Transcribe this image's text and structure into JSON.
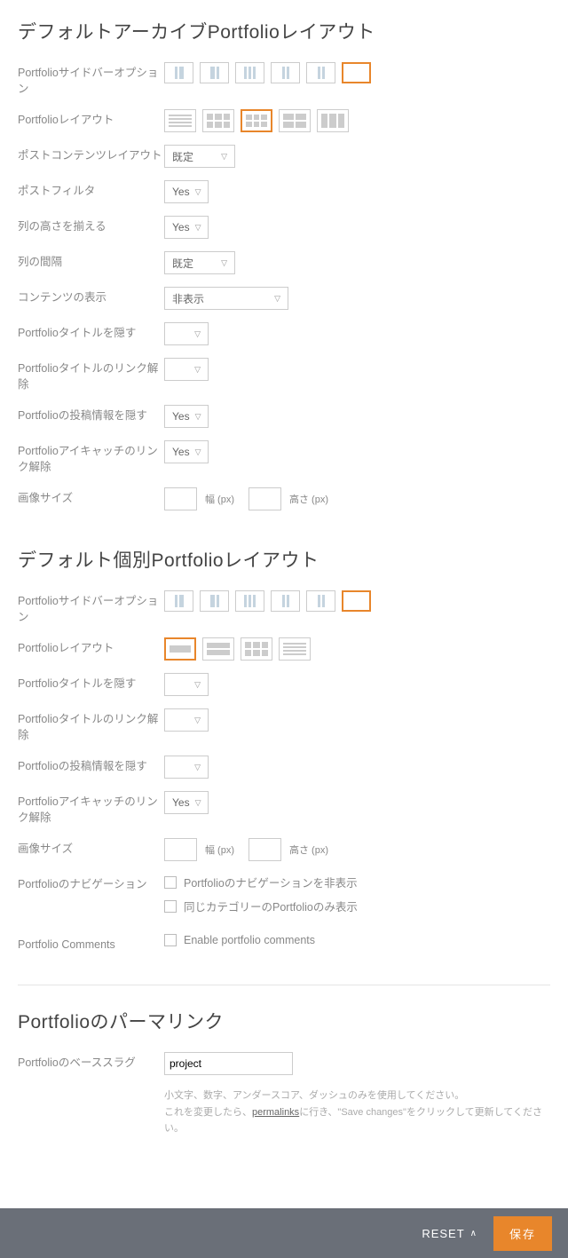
{
  "section1": {
    "title": "デフォルトアーカイブPortfolioレイアウト",
    "sidebar_opt_label": "Portfolioサイドバーオプション",
    "layout_label": "Portfolioレイアウト",
    "post_content_layout_label": "ポストコンテンツレイアウト",
    "post_content_layout_value": "既定",
    "post_filter_label": "ポストフィルタ",
    "post_filter_value": "Yes",
    "equalize_height_label": "列の高さを揃える",
    "equalize_height_value": "Yes",
    "column_gap_label": "列の間隔",
    "column_gap_value": "既定",
    "content_display_label": "コンテンツの表示",
    "content_display_value": "非表示",
    "hide_title_label": "Portfolioタイトルを隠す",
    "unlink_title_label": "Portfolioタイトルのリンク解除",
    "hide_meta_label": "Portfolioの投稿情報を隠す",
    "hide_meta_value": "Yes",
    "unlink_image_label": "Portfolioアイキャッチのリンク解除",
    "unlink_image_value": "Yes",
    "image_size_label": "画像サイズ",
    "width_unit": "幅 (px)",
    "height_unit": "高さ (px)"
  },
  "section2": {
    "title": "デフォルト個別Portfolioレイアウト",
    "sidebar_opt_label": "Portfolioサイドバーオプション",
    "layout_label": "Portfolioレイアウト",
    "hide_title_label": "Portfolioタイトルを隠す",
    "unlink_title_label": "Portfolioタイトルのリンク解除",
    "hide_meta_label": "Portfolioの投稿情報を隠す",
    "unlink_image_label": "Portfolioアイキャッチのリンク解除",
    "unlink_image_value": "Yes",
    "image_size_label": "画像サイズ",
    "width_unit": "幅 (px)",
    "height_unit": "高さ (px)",
    "nav_label": "Portfolioのナビゲーション",
    "nav_check1": "Portfolioのナビゲーションを非表示",
    "nav_check2": "同じカテゴリーのPortfolioのみ表示",
    "comments_label": "Portfolio Comments",
    "comments_check": "Enable portfolio comments"
  },
  "section3": {
    "title": "Portfolioのパーマリンク",
    "slug_label": "Portfolioのベーススラグ",
    "slug_value": "project",
    "help1": "小文字、数字、アンダースコア、ダッシュのみを使用してください。",
    "help2_a": "これを変更したら、",
    "help2_link": "permalinks",
    "help2_b": "に行き、\"Save changes\"をクリックして更新してください。"
  },
  "footer": {
    "reset": "RESET",
    "save": "保存"
  }
}
